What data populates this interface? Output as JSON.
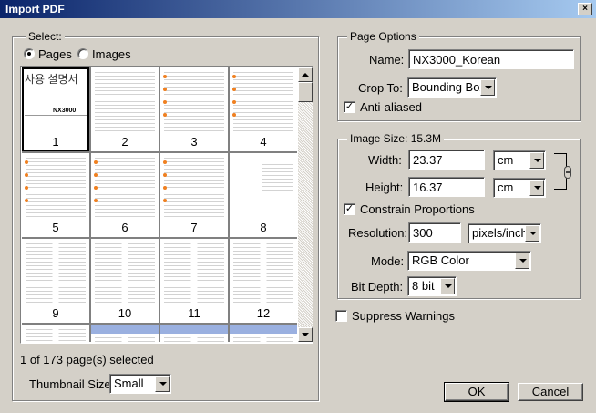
{
  "window": {
    "title": "Import PDF",
    "close_glyph": "×"
  },
  "select_group": {
    "legend": "Select:",
    "radio_pages": "Pages",
    "radio_images": "Images",
    "selected_mode": "Pages",
    "thumbnails": [
      {
        "num": "1",
        "selected": true,
        "style": "cover"
      },
      {
        "num": "2",
        "selected": false,
        "style": "text"
      },
      {
        "num": "3",
        "selected": false,
        "style": "orange"
      },
      {
        "num": "4",
        "selected": false,
        "style": "orange"
      },
      {
        "num": "5",
        "selected": false,
        "style": "orange"
      },
      {
        "num": "6",
        "selected": false,
        "style": "orange"
      },
      {
        "num": "7",
        "selected": false,
        "style": "orange"
      },
      {
        "num": "8",
        "selected": false,
        "style": "table"
      },
      {
        "num": "9",
        "selected": false,
        "style": "twocol"
      },
      {
        "num": "10",
        "selected": false,
        "style": "twocol"
      },
      {
        "num": "11",
        "selected": false,
        "style": "twocol"
      },
      {
        "num": "12",
        "selected": false,
        "style": "twocol"
      },
      {
        "num": "",
        "selected": false,
        "style": "twocol"
      },
      {
        "num": "",
        "selected": false,
        "style": "band"
      },
      {
        "num": "",
        "selected": false,
        "style": "band"
      },
      {
        "num": "",
        "selected": false,
        "style": "band"
      }
    ],
    "cover_text": {
      "title": "사용 설명서",
      "model": "NX3000"
    },
    "status": "1 of 173 page(s) selected",
    "thumbnail_size_label": "Thumbnail Size:",
    "thumbnail_size_value": "Small"
  },
  "page_options": {
    "legend": "Page Options",
    "name_label": "Name:",
    "name_value": "NX3000_Korean",
    "crop_label": "Crop To:",
    "crop_value": "Bounding Box",
    "anti_aliased_label": "Anti-aliased",
    "anti_aliased": true
  },
  "image_size": {
    "legend": "Image Size: 15.3M",
    "width_label": "Width:",
    "width_value": "23.37",
    "width_unit": "cm",
    "height_label": "Height:",
    "height_value": "16.37",
    "height_unit": "cm",
    "constrain_label": "Constrain Proportions",
    "constrain": true,
    "resolution_label": "Resolution:",
    "resolution_value": "300",
    "resolution_unit": "pixels/inch",
    "mode_label": "Mode:",
    "mode_value": "RGB Color",
    "bitdepth_label": "Bit Depth:",
    "bitdepth_value": "8 bit"
  },
  "suppress_warnings_label": "Suppress Warnings",
  "suppress_warnings": false,
  "buttons": {
    "ok": "OK",
    "cancel": "Cancel"
  },
  "check_glyph": "✓"
}
